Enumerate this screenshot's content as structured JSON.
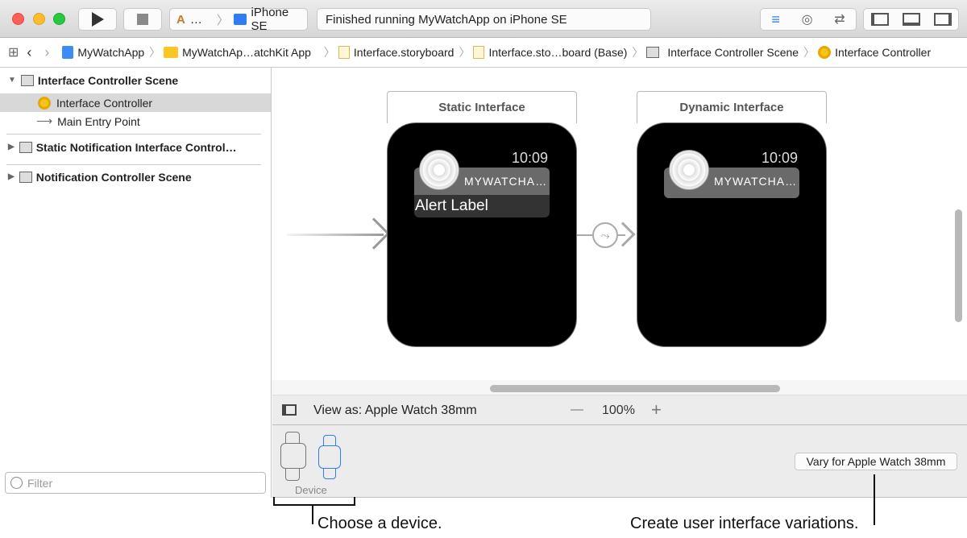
{
  "toolbar": {
    "scheme": "…",
    "device": "iPhone SE",
    "status": "Finished running MyWatchApp on iPhone SE"
  },
  "pathbar": {
    "items": [
      "MyWatchApp",
      "MyWatchAp…atchKit App",
      "Interface.storyboard",
      "Interface.sto…board (Base)",
      "Interface Controller Scene",
      "Interface Controller"
    ]
  },
  "outline": {
    "items": [
      {
        "label": "Interface Controller Scene"
      },
      {
        "label": "Interface Controller"
      },
      {
        "label": "Main Entry Point"
      },
      {
        "label": "Static Notification Interface Control…"
      },
      {
        "label": "Notification Controller Scene"
      }
    ],
    "filter_placeholder": "Filter"
  },
  "canvas": {
    "static": {
      "title": "Static Interface",
      "time": "10:09",
      "app": "MYWATCHA…",
      "alert": "Alert Label"
    },
    "dynamic": {
      "title": "Dynamic Interface",
      "time": "10:09",
      "app": "MYWATCHA…"
    }
  },
  "bottombar": {
    "view_as": "View as: Apple Watch 38mm",
    "zoom": "100%",
    "minus": "—",
    "plus": "+"
  },
  "devpanel": {
    "device_label": "Device",
    "vary_button": "Vary for Apple Watch 38mm"
  },
  "annotations": {
    "device": "Choose a device.",
    "vary": "Create user interface variations."
  },
  "colors": {
    "accent": "#2f7cf6",
    "selection": "#d8d8d8"
  }
}
